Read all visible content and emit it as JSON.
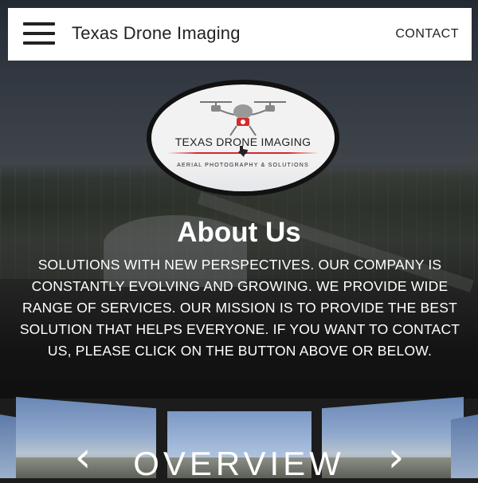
{
  "header": {
    "menu_icon": "hamburger-menu-icon",
    "title": "Texas Drone Imaging",
    "contact_label": "CONTACT"
  },
  "logo": {
    "name": "TEXAS DRONE IMAGING",
    "tagline": "AERIAL PHOTOGRAPHY & SOLUTIONS",
    "icon": "drone-camera-icon",
    "accent_color": "#d42a2a"
  },
  "about": {
    "heading": "About Us",
    "body": "SOLUTIONS WITH NEW PERSPECTIVES. OUR COMPANY IS CONSTANTLY EVOLVING AND GROWING. WE PROVIDE WIDE RANGE OF SERVICES. OUR MISSION IS TO PROVIDE THE BEST SOLUTION THAT HELPS EVERYONE. IF YOU WANT TO CONTACT US, PLEASE CLICK ON THE BUTTON ABOVE OR BELOW."
  },
  "carousel": {
    "prev_icon": "chevron-left-icon",
    "next_icon": "chevron-right-icon",
    "prev_glyph": "‹",
    "next_glyph": "›",
    "caption": "OVERVIEW"
  }
}
